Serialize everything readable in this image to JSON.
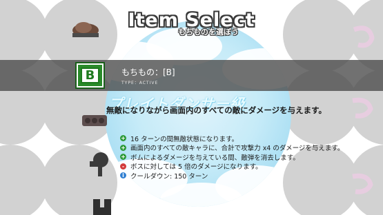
{
  "title": "Item Select",
  "subtitle": "もちものを選ぼう",
  "selected_item": {
    "grade_badge": "B",
    "label_line": "もちもの：[B]",
    "type_line": "TYPE：ACTIVE",
    "logo_name": "プレイトダンサー級",
    "description": "無敵になりながら画面内のすべての敵にダメージを与えます。",
    "effects": [
      {
        "icon": "plus",
        "text": "16 ターンの間無敵状態になります。"
      },
      {
        "icon": "plus",
        "text": "画面内のすべての敵キャラに、合計で攻撃力 x4 のダメージを与えます。"
      },
      {
        "icon": "plus",
        "text": "ボムによるダメージを与えている間、敵弾を消去します。"
      },
      {
        "icon": "minus",
        "text": "ボスに対しては 5 倍のダメージになります。"
      },
      {
        "icon": "info",
        "text": "クールダウン: 150 ターン"
      }
    ]
  },
  "colors": {
    "band": "#4e4e4e",
    "badge": "#2a8a2a",
    "sky": "#a9def3"
  }
}
